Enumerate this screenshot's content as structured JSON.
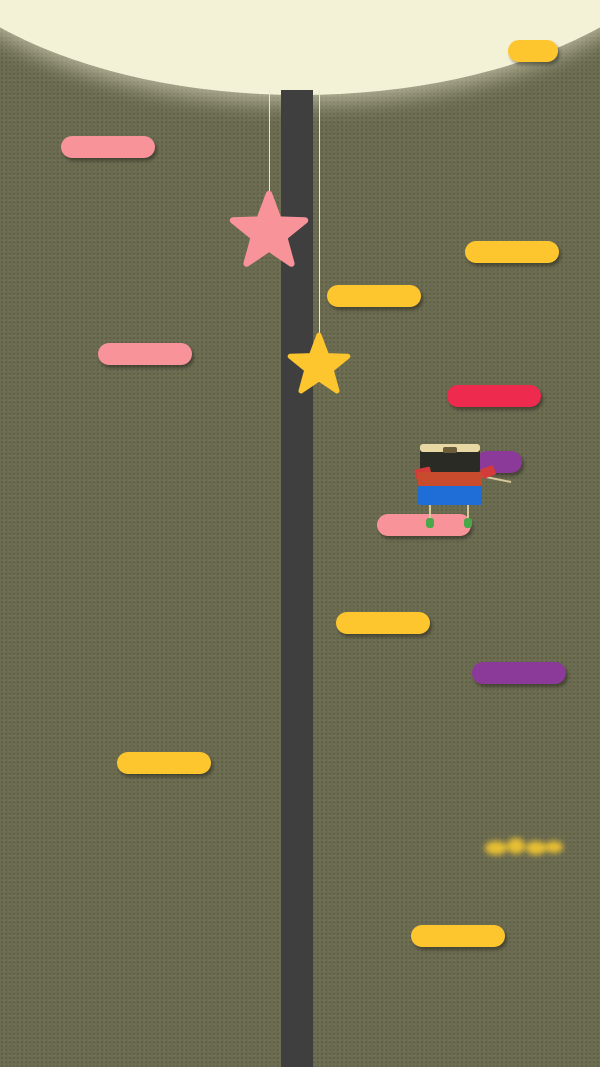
{
  "colors": {
    "background": "#6b6b50",
    "moon": "#f3f1d6",
    "pole": "#3f3f3f",
    "pink": "#f8939a",
    "yellow": "#fdc62e",
    "red": "#ee2a4f",
    "purple": "#8c3a99",
    "star_pink": "#f8939a",
    "star_yellow": "#fdc62e"
  },
  "platforms": [
    {
      "color": "yellow"
    },
    {
      "color": "pink"
    },
    {
      "color": "yellow"
    },
    {
      "color": "yellow"
    },
    {
      "color": "pink"
    },
    {
      "color": "red"
    },
    {
      "color": "purple"
    },
    {
      "color": "pink"
    },
    {
      "color": "yellow"
    },
    {
      "color": "purple"
    },
    {
      "color": "yellow"
    },
    {
      "color": "yellow"
    }
  ],
  "stars": [
    {
      "color": "pink",
      "icon": "star-icon"
    },
    {
      "color": "yellow",
      "icon": "star-icon"
    }
  ],
  "player": {
    "icon": "robot-character-icon"
  }
}
